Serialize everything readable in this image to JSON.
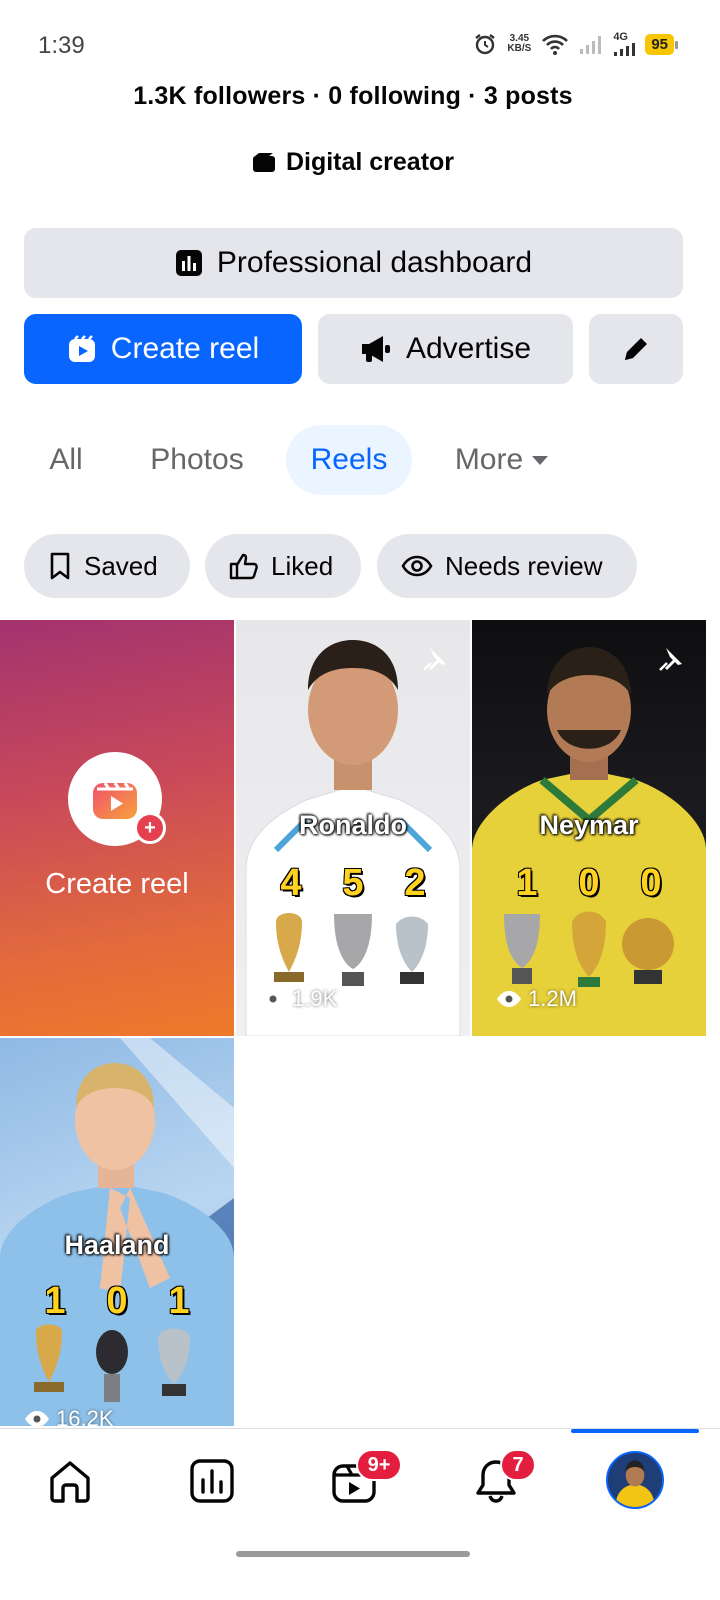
{
  "status_bar": {
    "time": "1:39",
    "net_speed_value": "3.45",
    "net_speed_unit": "KB/S",
    "network_type": "4G",
    "battery": "95"
  },
  "profile": {
    "stats": "1.3K followers · 0 following · 3 posts",
    "category": "Digital creator"
  },
  "actions": {
    "dashboard_label": "Professional dashboard",
    "create_reel_label": "Create reel",
    "advertise_label": "Advertise"
  },
  "tabs": [
    {
      "label": "All",
      "active": false
    },
    {
      "label": "Photos",
      "active": false
    },
    {
      "label": "Reels",
      "active": true
    },
    {
      "label": "More",
      "active": false
    }
  ],
  "filters": [
    {
      "label": "Saved",
      "icon": "bookmark-icon"
    },
    {
      "label": "Liked",
      "icon": "thumbs-up-icon"
    },
    {
      "label": "Needs review",
      "icon": "eye-icon"
    }
  ],
  "create_tile": {
    "label": "Create reel",
    "plus": "+"
  },
  "reels": [
    {
      "name": "Ronaldo",
      "trophies": [
        "4",
        "5",
        "2"
      ],
      "views": "1.9K",
      "pinned": true
    },
    {
      "name": "Neymar",
      "trophies": [
        "1",
        "0",
        "0"
      ],
      "views": "1.2M",
      "pinned": true
    },
    {
      "name": "Haaland",
      "trophies": [
        "1",
        "0",
        "1"
      ],
      "views": "16.2K",
      "pinned": false
    }
  ],
  "nav": {
    "reels_badge": "9+",
    "notifications_badge": "7"
  },
  "colors": {
    "accent": "#0866ff",
    "button_gray": "#e4e6eb",
    "badge_red": "#e41e3f",
    "battery_yellow": "#f7c600"
  }
}
